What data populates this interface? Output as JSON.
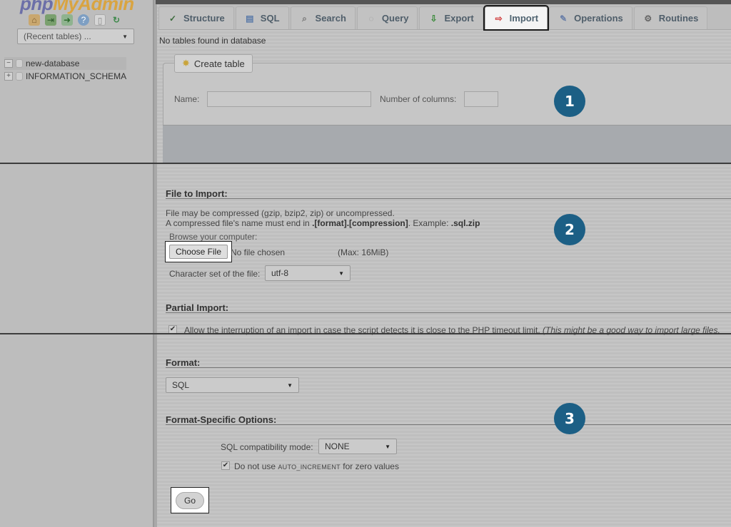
{
  "sidebar": {
    "logo_php": "php",
    "logo_myadmin": "MyAdmin",
    "icons": [
      "home-icon",
      "logout-icon",
      "sql-query-icon",
      "help-icon",
      "docs-icon",
      "reload-icon"
    ],
    "recent_tables": "(Recent tables) ...",
    "databases": [
      {
        "name": "new-database",
        "expander": "−"
      },
      {
        "name": "INFORMATION_SCHEMA",
        "expander": "+"
      }
    ]
  },
  "tabs": [
    {
      "label": "Structure",
      "icon": "structure-icon",
      "glyph": "✓"
    },
    {
      "label": "SQL",
      "icon": "sql-icon",
      "glyph": "▤"
    },
    {
      "label": "Search",
      "icon": "search-icon",
      "glyph": "⌕"
    },
    {
      "label": "Query",
      "icon": "query-icon",
      "glyph": "◌"
    },
    {
      "label": "Export",
      "icon": "export-icon",
      "glyph": "⇩"
    },
    {
      "label": "Import",
      "icon": "import-icon",
      "glyph": "⇨",
      "active": true
    },
    {
      "label": "Operations",
      "icon": "operations-icon",
      "glyph": "✎"
    },
    {
      "label": "Routines",
      "icon": "routines-icon",
      "glyph": "⚙"
    }
  ],
  "main": {
    "no_tables": "No tables found in database",
    "create_table": {
      "button_label": "Create table",
      "name_label": "Name:",
      "name_value": "",
      "columns_label": "Number of columns:",
      "columns_value": ""
    },
    "file_to_import": {
      "title": "File to Import:",
      "line1": "File may be compressed (gzip, bzip2, zip) or uncompressed.",
      "line2_prefix": "A compressed file's name must end in ",
      "line2_format": ".[format].[compression]",
      "line2_mid": ". Example: ",
      "line2_example": ".sql.zip",
      "browse_label": "Browse your computer:",
      "choose_file": "Choose File",
      "no_file": "No file chosen",
      "max_size": "(Max: 16MiB)",
      "charset_label": "Character set of the file:",
      "charset_value": "utf-8"
    },
    "partial_import": {
      "title": "Partial Import:",
      "checked": true,
      "text": "Allow the interruption of an import in case the script detects it is close to the PHP timeout limit.",
      "note": "(This might be a good way to import large files,"
    },
    "format": {
      "title": "Format:",
      "value": "SQL"
    },
    "format_options": {
      "title": "Format-Specific Options:",
      "compat_label": "SQL compatibility mode:",
      "compat_value": "NONE",
      "autoinc_checked": true,
      "autoinc_prefix": "Do not use ",
      "autoinc_keyword": "AUTO_INCREMENT",
      "autoinc_suffix": " for zero values"
    },
    "go_label": "Go"
  },
  "badges": [
    "1",
    "2",
    "3"
  ],
  "colors": {
    "badge": "#1c5f85",
    "logo_php": "#6c6fa8",
    "logo_myadmin": "#d9a441"
  }
}
